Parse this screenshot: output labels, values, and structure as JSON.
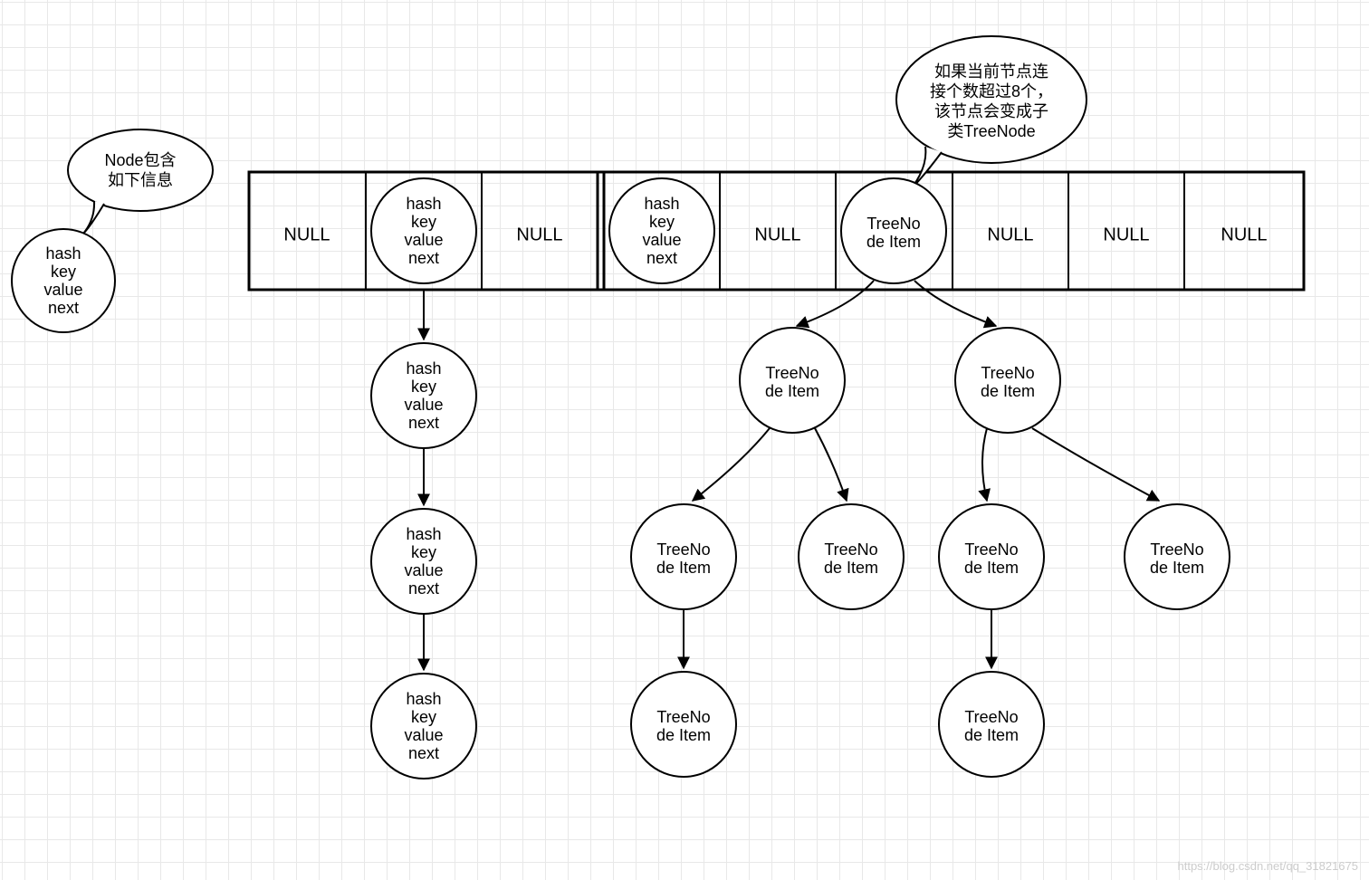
{
  "watermark": "https://blog.csdn.net/qq_31821675",
  "bubbleLeft": {
    "line1": "Node包含",
    "line2": "如下信息"
  },
  "bubbleRight": {
    "line1": "如果当前节点连",
    "line2": "接个数超过8个，",
    "line3": "该节点会变成子",
    "line4": "类TreeNode"
  },
  "nodeFields": {
    "f1": "hash",
    "f2": "key",
    "f3": "value",
    "f4": "next"
  },
  "treeNode": {
    "l1": "TreeNo",
    "l2": "de Item"
  },
  "cells": {
    "null": "NULL"
  }
}
